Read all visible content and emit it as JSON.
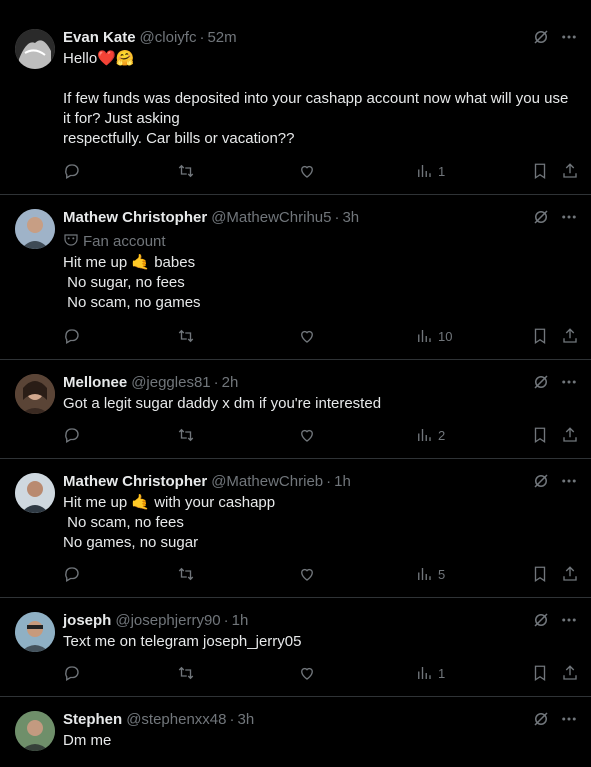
{
  "posts": [
    {
      "name": "Evan Kate",
      "handle": "@cloiyfc",
      "time": "52m",
      "fan_label": "",
      "text": "Hello❤️🤗\n\nIf few funds was deposited into your cashapp account now what will you use it for? Just asking\nrespectfully. Car bills or vacation??",
      "views": "1",
      "avatar_color": "#8a8a8a"
    },
    {
      "name": "Mathew Christopher",
      "handle": "@MathewChrihu5",
      "time": "3h",
      "fan_label": "Fan account",
      "text": "Hit me up 🤙 babes\n No sugar, no fees\n No scam, no games",
      "views": "10",
      "avatar_color": "#6b7d8f"
    },
    {
      "name": "Mellonee",
      "handle": "@jeggles81",
      "time": "2h",
      "fan_label": "",
      "text": "Got a legit sugar daddy x dm if you're interested",
      "views": "2",
      "avatar_color": "#7a5a4a"
    },
    {
      "name": "Mathew Christopher",
      "handle": "@MathewChrieb",
      "time": "1h",
      "fan_label": "",
      "text": "Hit me up 🤙 with your cashapp\n No scam, no fees\nNo games, no sugar",
      "views": "5",
      "avatar_color": "#8fa0b0"
    },
    {
      "name": "joseph",
      "handle": "@josephjerry90",
      "time": "1h",
      "fan_label": "",
      "text": "Text me on telegram joseph_jerry05",
      "views": "1",
      "avatar_color": "#4f6b78"
    },
    {
      "name": "Stephen",
      "handle": "@stephenxx48",
      "time": "3h",
      "fan_label": "",
      "text": "Dm me",
      "views": "",
      "avatar_color": "#5e7a5e"
    }
  ],
  "icons": {
    "grok": "grok-icon",
    "more": "more-icon",
    "reply": "reply-icon",
    "retweet": "retweet-icon",
    "like": "like-icon",
    "views": "views-icon",
    "bookmark": "bookmark-icon",
    "share": "share-icon"
  },
  "colors": {
    "background": "#000000",
    "text": "#e7e9ea",
    "muted": "#71767b",
    "divider": "#2f3336"
  }
}
